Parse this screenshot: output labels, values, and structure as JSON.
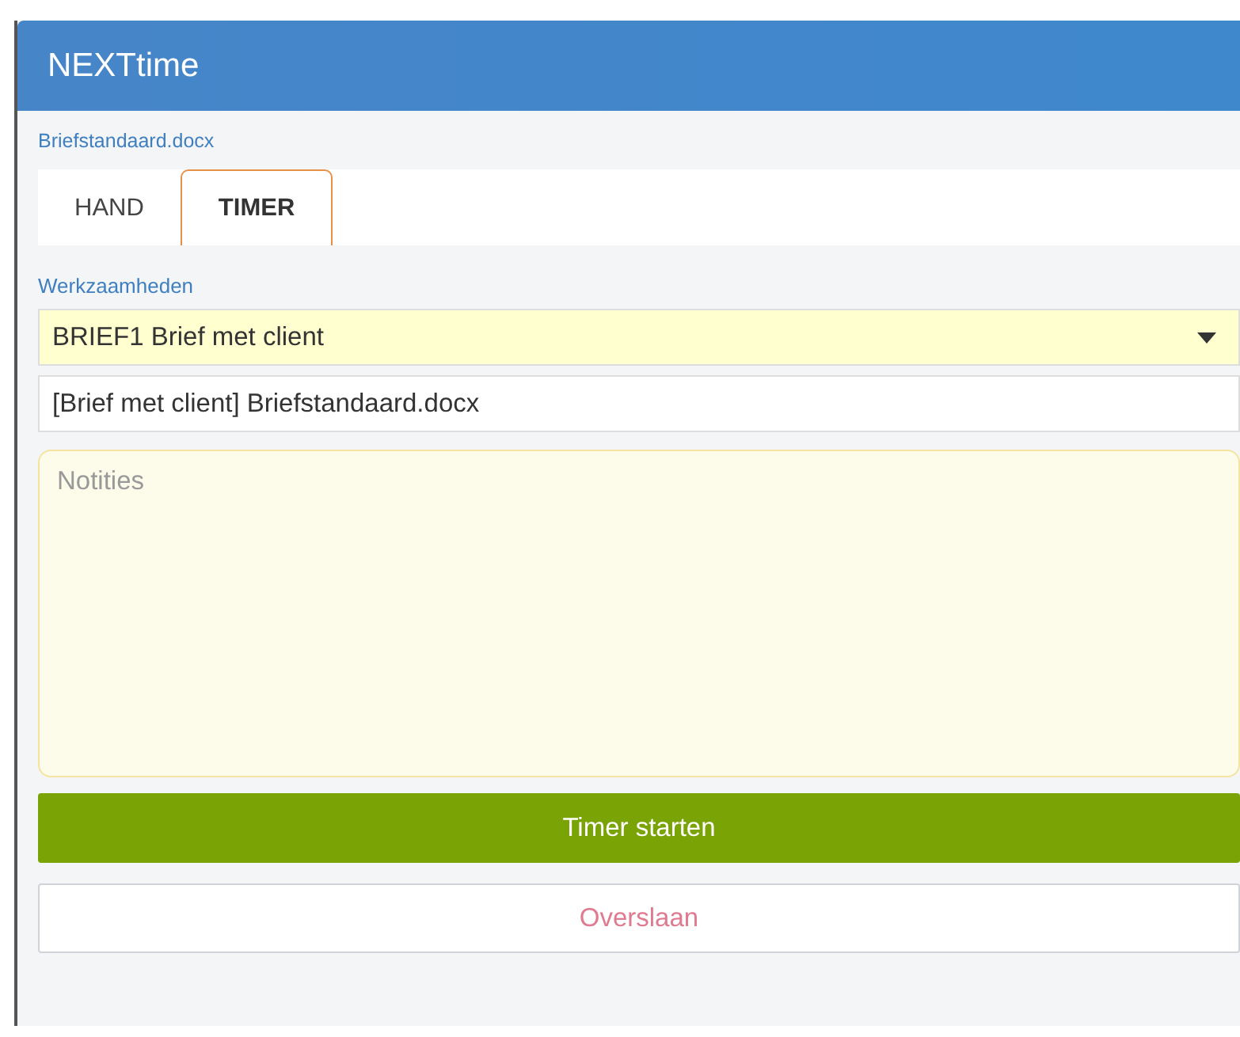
{
  "window": {
    "title": "NEXTtime"
  },
  "document": "Briefstandaard.docx",
  "tabs": [
    {
      "label": "HAND",
      "selected": false
    },
    {
      "label": "TIMER",
      "selected": true
    }
  ],
  "activity": {
    "label": "Werkzaamheden",
    "value": "BRIEF1 Brief met client"
  },
  "description": {
    "value": "[Brief met client] Briefstandaard.docx"
  },
  "notes": {
    "placeholder": "Notities"
  },
  "buttons": [
    {
      "label": "Timer starten",
      "kind": "primary"
    },
    {
      "label": "Overslaan",
      "kind": "secondary"
    }
  ]
}
